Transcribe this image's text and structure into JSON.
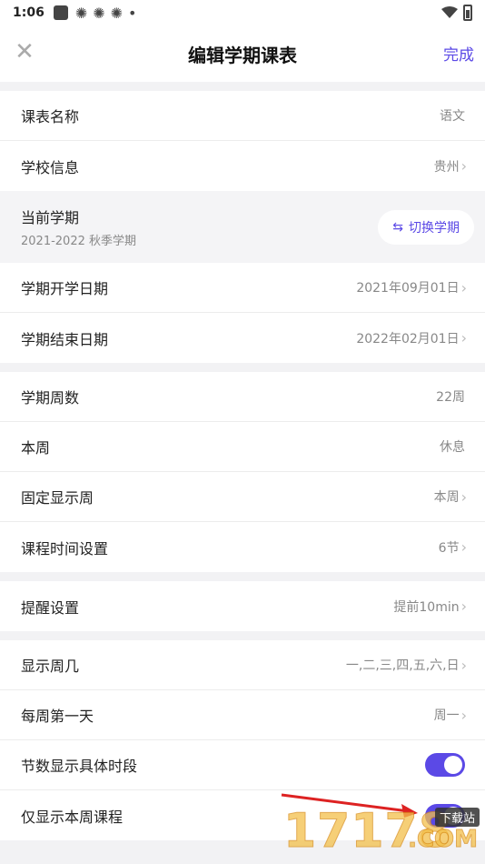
{
  "status": {
    "time": "1:06",
    "dot": "•"
  },
  "header": {
    "title": "编辑学期课表",
    "done": "完成",
    "close": "✕"
  },
  "group1": [
    {
      "label": "课表名称",
      "value": "语文",
      "chevron": false
    },
    {
      "label": "学校信息",
      "value": "贵州",
      "chevron": true
    }
  ],
  "term": {
    "label": "当前学期",
    "sub": "2021-2022 秋季学期",
    "switch": "切换学期",
    "switch_icon": "⇆"
  },
  "group2": [
    {
      "label": "学期开学日期",
      "value": "2021年09月01日"
    },
    {
      "label": "学期结束日期",
      "value": "2022年02月01日"
    }
  ],
  "group3": [
    {
      "label": "学期周数",
      "value": "22周"
    },
    {
      "label": "本周",
      "value": "休息"
    },
    {
      "label": "固定显示周",
      "value": "本周"
    },
    {
      "label": "课程时间设置",
      "value": "6节"
    }
  ],
  "group4": [
    {
      "label": "提醒设置",
      "value": "提前10min"
    }
  ],
  "group5": [
    {
      "label": "显示周几",
      "value": "一,二,三,四,五,六,日"
    },
    {
      "label": "每周第一天",
      "value": "周一"
    },
    {
      "label": "节数显示具体时段",
      "toggle_on": true
    },
    {
      "label": "仅显示本周课程",
      "toggle_on": true
    }
  ],
  "chevron": "›",
  "colors": {
    "accent": "#5b49e6"
  },
  "watermark": {
    "digits": "17178",
    "suffix": ".COM",
    "badge": "下载站"
  }
}
